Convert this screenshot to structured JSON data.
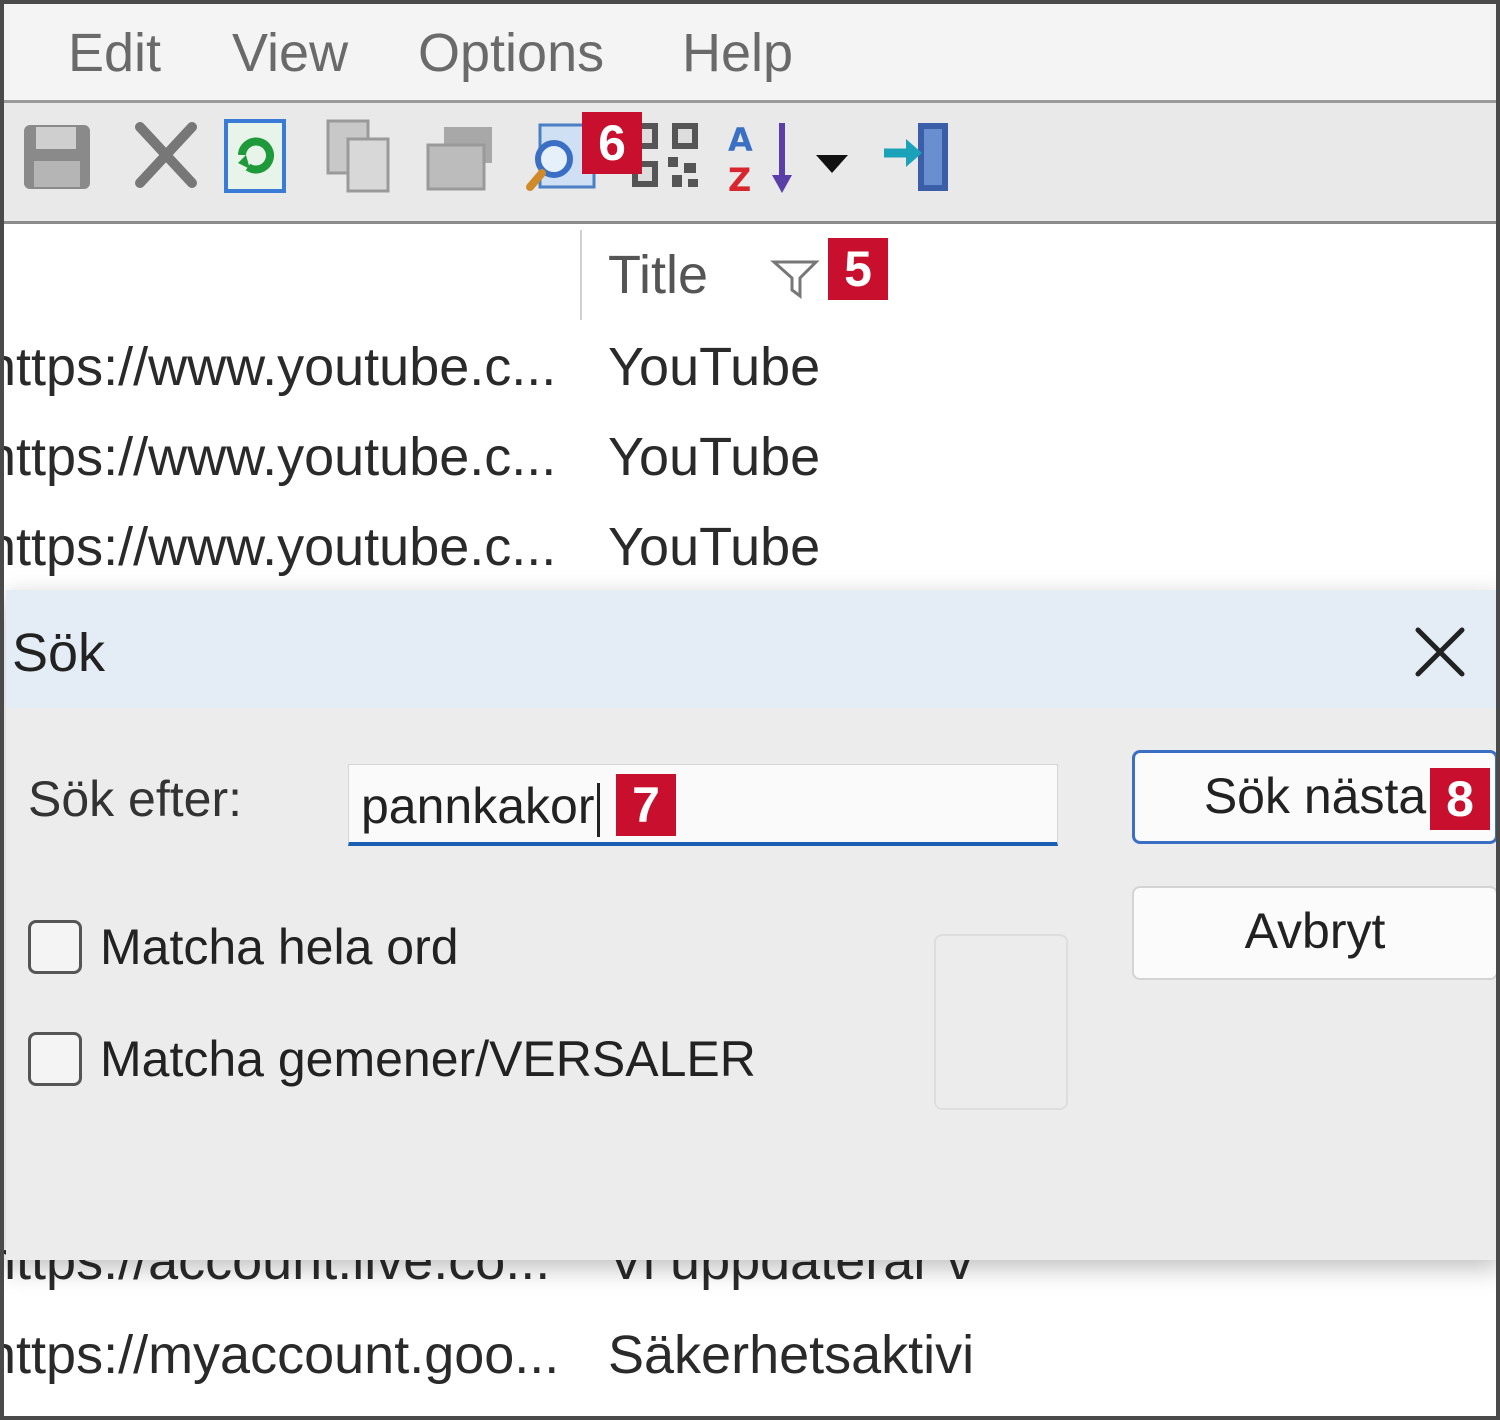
{
  "menu": {
    "items": [
      "Edit",
      "View",
      "Options",
      "Help"
    ]
  },
  "toolbar": {
    "icons": [
      "save-icon",
      "delete-icon",
      "refresh-icon",
      "copy-icon",
      "properties-icon",
      "find-icon",
      "qr-code-icon",
      "sort-az-icon",
      "dropdown-arrow-icon",
      "exit-icon"
    ]
  },
  "list": {
    "columns": {
      "title": "Title"
    },
    "rows": [
      {
        "url": "https://www.youtube.c...",
        "title": "YouTube"
      },
      {
        "url": "https://www.youtube.c...",
        "title": "YouTube"
      },
      {
        "url": "https://www.youtube.c...",
        "title": "YouTube"
      },
      {
        "url": "https://account.live.co...",
        "title": "Vi uppdaterar v"
      },
      {
        "url": "https://myaccount.goo...",
        "title": "Säkerhetsaktivi"
      }
    ]
  },
  "badges": {
    "b5": "5",
    "b6": "6",
    "b7": "7",
    "b8": "8"
  },
  "dialog": {
    "title": "Sök",
    "search_label": "Sök efter:",
    "search_value": "pannkakor",
    "find_next_label": "Sök nästa",
    "cancel_label": "Avbryt",
    "match_whole_word": {
      "label": "Matcha hela ord",
      "checked": false
    },
    "match_case": {
      "label": "Matcha gemener/VERSALER",
      "checked": false
    }
  },
  "colors": {
    "badge": "#c8102e",
    "accent": "#1a5fb4",
    "dialog_titlebar": "#e4edf5"
  }
}
